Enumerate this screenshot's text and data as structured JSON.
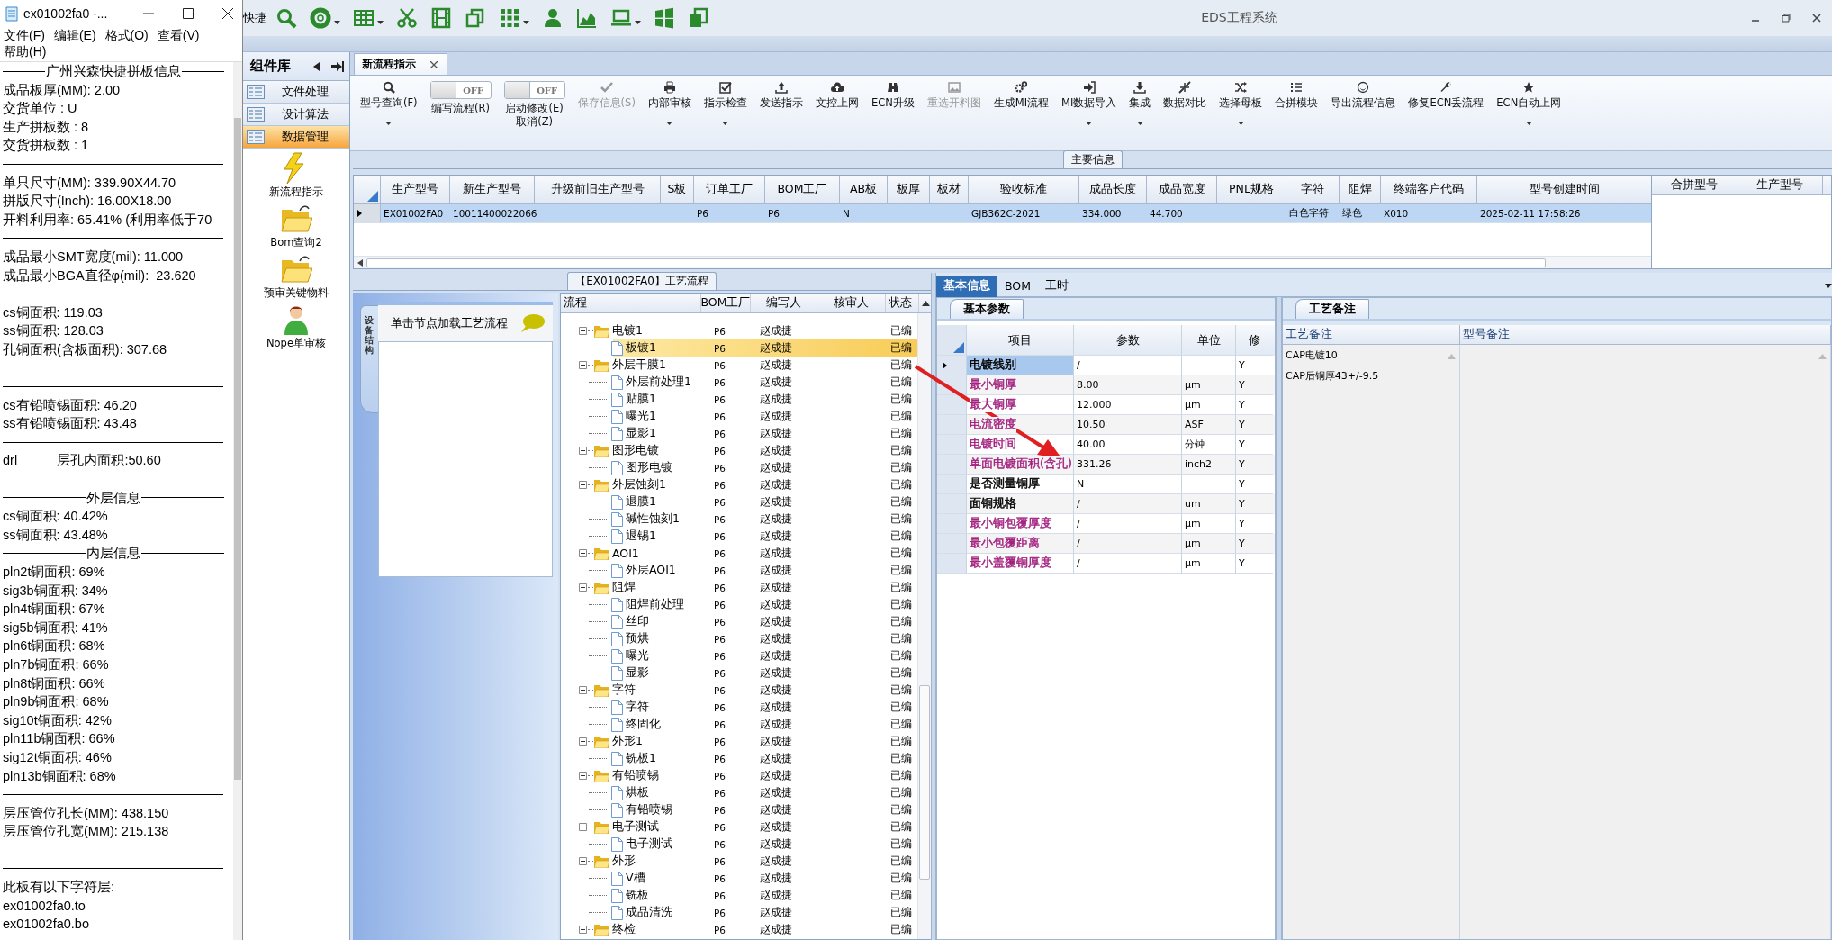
{
  "notepad": {
    "title": "ex01002fa0 -...",
    "menu": [
      "文件(F)",
      "编辑(E)",
      "格式(O)",
      "查看(V)",
      "帮助(H)"
    ],
    "lines": [
      {
        "kind": "heading",
        "text": "广州兴森快捷拼板信息"
      },
      {
        "kind": "text",
        "text": "成品板厚(MM): 2.00"
      },
      {
        "kind": "text",
        "text": "交货单位 : U"
      },
      {
        "kind": "text",
        "text": "生产拼板数 : 8"
      },
      {
        "kind": "text",
        "text": "交货拼板数 : 1"
      },
      {
        "kind": "rule"
      },
      {
        "kind": "text",
        "text": "单只尺寸(MM): 339.90X44.70"
      },
      {
        "kind": "text",
        "text": "拼版尺寸(Inch): 16.00X18.00"
      },
      {
        "kind": "text",
        "text": "开料利用率: 65.41% (利用率低于70"
      },
      {
        "kind": "rule"
      },
      {
        "kind": "text",
        "text": "成品最小SMT宽度(mil): 11.000"
      },
      {
        "kind": "text",
        "text": "成品最小BGA直径φ(mil):  23.620"
      },
      {
        "kind": "rule"
      },
      {
        "kind": "text",
        "text": "cs铜面积: 119.03"
      },
      {
        "kind": "text",
        "text": "ss铜面积: 128.03"
      },
      {
        "kind": "text",
        "text": "孔铜面积(含板面积): 307.68"
      },
      {
        "kind": "blank"
      },
      {
        "kind": "rule"
      },
      {
        "kind": "text",
        "text": "cs有铅喷锡面积: 46.20"
      },
      {
        "kind": "text",
        "text": "ss有铅喷锡面积: 43.48"
      },
      {
        "kind": "rule"
      },
      {
        "kind": "text",
        "text": "drl           层孔内面积:50.60"
      },
      {
        "kind": "blank"
      },
      {
        "kind": "heading",
        "text": "外层信息"
      },
      {
        "kind": "text",
        "text": "cs铜面积: 40.42%"
      },
      {
        "kind": "text",
        "text": "ss铜面积: 43.48%"
      },
      {
        "kind": "heading",
        "text": "内层信息"
      },
      {
        "kind": "text",
        "text": "pln2t铜面积: 69%"
      },
      {
        "kind": "text",
        "text": "sig3b铜面积: 34%"
      },
      {
        "kind": "text",
        "text": "pln4t铜面积: 67%"
      },
      {
        "kind": "text",
        "text": "sig5b铜面积: 41%"
      },
      {
        "kind": "text",
        "text": "pln6t铜面积: 68%"
      },
      {
        "kind": "text",
        "text": "pln7b铜面积: 66%"
      },
      {
        "kind": "text",
        "text": "pln8t铜面积: 66%"
      },
      {
        "kind": "text",
        "text": "pln9b铜面积: 68%"
      },
      {
        "kind": "text",
        "text": "sig10t铜面积: 42%"
      },
      {
        "kind": "text",
        "text": "pln11b铜面积: 66%"
      },
      {
        "kind": "text",
        "text": "sig12t铜面积: 46%"
      },
      {
        "kind": "text",
        "text": "pln13b铜面积: 68%"
      },
      {
        "kind": "rule"
      },
      {
        "kind": "text",
        "text": "层压管位孔长(MM): 438.150"
      },
      {
        "kind": "text",
        "text": "层压管位孔宽(MM): 215.138"
      },
      {
        "kind": "blank"
      },
      {
        "kind": "rule"
      },
      {
        "kind": "text",
        "text": "此板有以下字符层:"
      },
      {
        "kind": "text",
        "text": "ex01002fa0.to"
      },
      {
        "kind": "text",
        "text": "ex01002fa0.bo"
      }
    ]
  },
  "app": {
    "quick_label": "快捷",
    "title": "EDS工程系统"
  },
  "component_library": {
    "title": "组件库",
    "groups": [
      {
        "label": "文件处理",
        "selected": false
      },
      {
        "label": "设计算法",
        "selected": false
      },
      {
        "label": "数据管理",
        "selected": true
      }
    ],
    "tools": [
      "新流程指示",
      "Bom查询2",
      "预审关键物料",
      "Nope单审核"
    ]
  },
  "doc_tabs": [
    {
      "label": "新流程指示",
      "selected": true
    }
  ],
  "ribbon": [
    {
      "kind": "button",
      "label": "型号查询(F)",
      "disabled": false,
      "dropdown": true
    },
    {
      "kind": "toggle",
      "label": "编写流程(R)",
      "switch": "OFF",
      "on": false,
      "disabled": false
    },
    {
      "kind": "toggle",
      "label": "启动修改(E)\n取消(Z)",
      "switch": "OFF",
      "on": false,
      "disabled": false
    },
    {
      "kind": "button",
      "label": "保存信息(S)",
      "disabled": true,
      "dropdown": false
    },
    {
      "kind": "button",
      "label": "内部审核",
      "disabled": false,
      "dropdown": true
    },
    {
      "kind": "button",
      "label": "指示检查",
      "disabled": false,
      "dropdown": true
    },
    {
      "kind": "button",
      "label": "发送指示",
      "disabled": false,
      "dropdown": false
    },
    {
      "kind": "button",
      "label": "文控上网",
      "disabled": false,
      "dropdown": false
    },
    {
      "kind": "button",
      "label": "ECN升级",
      "disabled": false,
      "dropdown": false
    },
    {
      "kind": "button",
      "label": "重选开料图",
      "disabled": true,
      "dropdown": false
    },
    {
      "kind": "button",
      "label": "生成MI流程",
      "disabled": false,
      "dropdown": false
    },
    {
      "kind": "button",
      "label": "MI数据导入",
      "disabled": false,
      "dropdown": true
    },
    {
      "kind": "button",
      "label": "集成",
      "disabled": false,
      "dropdown": true
    },
    {
      "kind": "button",
      "label": "数据对比",
      "disabled": false,
      "dropdown": false
    },
    {
      "kind": "button",
      "label": "选择母板",
      "disabled": false,
      "dropdown": true
    },
    {
      "kind": "button",
      "label": "合拼模块",
      "disabled": false,
      "dropdown": false
    },
    {
      "kind": "button",
      "label": "导出流程信息",
      "disabled": false,
      "dropdown": false
    },
    {
      "kind": "button",
      "label": "修复ECN丢流程",
      "disabled": false,
      "dropdown": false
    },
    {
      "kind": "button",
      "label": "ECN自动上网",
      "disabled": false,
      "dropdown": true
    }
  ],
  "main_info": {
    "legend": "主要信息",
    "columns": [
      "生产型号",
      "新生产型号",
      "升级前旧生产型号",
      "S板",
      "订单工厂",
      "BOM工厂",
      "AB板",
      "板厚",
      "板材",
      "验收标准",
      "成品长度",
      "成品宽度",
      "PNL规格",
      "字符",
      "阻焊",
      "终端客户代码",
      "型号创建时间"
    ],
    "rows": [
      {
        "selected": true,
        "cells": [
          "EX01002FA0",
          "10011400022066",
          null,
          null,
          "P6",
          "P6",
          "N",
          null,
          null,
          "GJB362C-2021",
          "334.000",
          "44.700",
          null,
          "白色字符",
          "绿色",
          "X010",
          "2025-02-11 17:58:26"
        ]
      }
    ],
    "merge_columns": [
      "合拼型号",
      "生产型号"
    ]
  },
  "process": {
    "legend": "【EX01002FA0】工艺流程",
    "side_tab": "设备结构",
    "hint": "单击节点加载工艺流程",
    "columns": [
      "流程",
      "BOM工厂",
      "编写人",
      "核审人",
      "状态"
    ],
    "rows": [
      {
        "name": "电镀1",
        "bom": "P6",
        "writer": "赵成捷",
        "status": "已编",
        "expanded": true,
        "selected": false,
        "children": [
          {
            "name": "板镀1",
            "bom": "P6",
            "writer": "赵成捷",
            "status": "已编",
            "selected": true
          }
        ]
      },
      {
        "name": "外层干膜1",
        "bom": "P6",
        "writer": "赵成捷",
        "status": "已编",
        "expanded": true,
        "selected": false,
        "children": [
          {
            "name": "外层前处理1",
            "bom": "P6",
            "writer": "赵成捷",
            "status": "已编",
            "selected": false
          },
          {
            "name": "贴膜1",
            "bom": "P6",
            "writer": "赵成捷",
            "status": "已编",
            "selected": false
          },
          {
            "name": "曝光1",
            "bom": "P6",
            "writer": "赵成捷",
            "status": "已编",
            "selected": false
          },
          {
            "name": "显影1",
            "bom": "P6",
            "writer": "赵成捷",
            "status": "已编",
            "selected": false
          }
        ]
      },
      {
        "name": "图形电镀",
        "bom": "P6",
        "writer": "赵成捷",
        "status": "已编",
        "expanded": true,
        "selected": false,
        "children": [
          {
            "name": "图形电镀",
            "bom": "P6",
            "writer": "赵成捷",
            "status": "已编",
            "selected": false
          }
        ]
      },
      {
        "name": "外层蚀刻1",
        "bom": "P6",
        "writer": "赵成捷",
        "status": "已编",
        "expanded": true,
        "selected": false,
        "children": [
          {
            "name": "退膜1",
            "bom": "P6",
            "writer": "赵成捷",
            "status": "已编",
            "selected": false
          },
          {
            "name": "碱性蚀刻1",
            "bom": "P6",
            "writer": "赵成捷",
            "status": "已编",
            "selected": false
          },
          {
            "name": "退锡1",
            "bom": "P6",
            "writer": "赵成捷",
            "status": "已编",
            "selected": false
          }
        ]
      },
      {
        "name": "AOI1",
        "bom": "P6",
        "writer": "赵成捷",
        "status": "已编",
        "expanded": true,
        "selected": false,
        "children": [
          {
            "name": "外层AOI1",
            "bom": "P6",
            "writer": "赵成捷",
            "status": "已编",
            "selected": false
          }
        ]
      },
      {
        "name": "阻焊",
        "bom": "P6",
        "writer": "赵成捷",
        "status": "已编",
        "expanded": true,
        "selected": false,
        "children": [
          {
            "name": "阻焊前处理",
            "bom": "P6",
            "writer": "赵成捷",
            "status": "已编",
            "selected": false
          },
          {
            "name": "丝印",
            "bom": "P6",
            "writer": "赵成捷",
            "status": "已编",
            "selected": false
          },
          {
            "name": "预烘",
            "bom": "P6",
            "writer": "赵成捷",
            "status": "已编",
            "selected": false
          },
          {
            "name": "曝光",
            "bom": "P6",
            "writer": "赵成捷",
            "status": "已编",
            "selected": false
          },
          {
            "name": "显影",
            "bom": "P6",
            "writer": "赵成捷",
            "status": "已编",
            "selected": false
          }
        ]
      },
      {
        "name": "字符",
        "bom": "P6",
        "writer": "赵成捷",
        "status": "已编",
        "expanded": true,
        "selected": false,
        "children": [
          {
            "name": "字符",
            "bom": "P6",
            "writer": "赵成捷",
            "status": "已编",
            "selected": false
          },
          {
            "name": "终固化",
            "bom": "P6",
            "writer": "赵成捷",
            "status": "已编",
            "selected": false
          }
        ]
      },
      {
        "name": "外形1",
        "bom": "P6",
        "writer": "赵成捷",
        "status": "已编",
        "expanded": true,
        "selected": false,
        "children": [
          {
            "name": "铣板1",
            "bom": "P6",
            "writer": "赵成捷",
            "status": "已编",
            "selected": false
          }
        ]
      },
      {
        "name": "有铅喷锡",
        "bom": "P6",
        "writer": "赵成捷",
        "status": "已编",
        "expanded": true,
        "selected": false,
        "children": [
          {
            "name": "烘板",
            "bom": "P6",
            "writer": "赵成捷",
            "status": "已编",
            "selected": false
          },
          {
            "name": "有铅喷锡",
            "bom": "P6",
            "writer": "赵成捷",
            "status": "已编",
            "selected": false
          }
        ]
      },
      {
        "name": "电子测试",
        "bom": "P6",
        "writer": "赵成捷",
        "status": "已编",
        "expanded": true,
        "selected": false,
        "children": [
          {
            "name": "电子测试",
            "bom": "P6",
            "writer": "赵成捷",
            "status": "已编",
            "selected": false
          }
        ]
      },
      {
        "name": "外形",
        "bom": "P6",
        "writer": "赵成捷",
        "status": "已编",
        "expanded": true,
        "selected": false,
        "children": [
          {
            "name": "V槽",
            "bom": "P6",
            "writer": "赵成捷",
            "status": "已编",
            "selected": false
          },
          {
            "name": "铣板",
            "bom": "P6",
            "writer": "赵成捷",
            "status": "已编",
            "selected": false
          },
          {
            "name": "成品清洗",
            "bom": "P6",
            "writer": "赵成捷",
            "status": "已编",
            "selected": false
          }
        ]
      },
      {
        "name": "终检",
        "bom": "P6",
        "writer": "赵成捷",
        "status": "已编",
        "expanded": true,
        "selected": false
      }
    ]
  },
  "detail": {
    "tabs": [
      {
        "label": "基本信息",
        "selected": true
      },
      {
        "label": "BOM",
        "selected": false
      },
      {
        "label": "工时",
        "selected": false
      }
    ],
    "params": {
      "tab": "基本参数",
      "columns": [
        "项目",
        "参数",
        "单位",
        "修"
      ],
      "rows": [
        {
          "item": "电镀线别",
          "value": "/",
          "modified": "Y",
          "color": "#000000",
          "selected": true
        },
        {
          "item": "最小铜厚",
          "value": "8.00",
          "unit": "μm",
          "modified": "Y",
          "color": "#a3217f",
          "selected": false
        },
        {
          "item": "最大铜厚",
          "value": "12.000",
          "unit": "μm",
          "modified": "Y",
          "color": "#a3217f",
          "selected": false
        },
        {
          "item": "电流密度",
          "value": "10.50",
          "unit": "ASF",
          "modified": "Y",
          "color": "#a3217f",
          "selected": false
        },
        {
          "item": "电镀时间",
          "value": "40.00",
          "unit": "分钟",
          "modified": "Y",
          "color": "#a3217f",
          "selected": false
        },
        {
          "item": "单面电镀面积(含孔)",
          "value": "331.26",
          "unit": "inch2",
          "modified": "Y",
          "color": "#a3217f",
          "selected": false
        },
        {
          "item": "是否测量铜厚",
          "value": "N",
          "modified": "Y",
          "color": "#000000",
          "selected": false
        },
        {
          "item": "面铜规格",
          "value": "/",
          "unit": "um",
          "modified": "Y",
          "color": "#000000",
          "selected": false
        },
        {
          "item": "最小铜包覆厚度",
          "value": "/",
          "unit": "μm",
          "modified": "Y",
          "color": "#a3217f",
          "selected": false
        },
        {
          "item": "最小包覆距离",
          "value": "/",
          "unit": "μm",
          "modified": "Y",
          "color": "#a3217f",
          "selected": false
        },
        {
          "item": "最小盖覆铜厚度",
          "value": "/",
          "unit": "μm",
          "modified": "Y",
          "color": "#a3217f",
          "selected": false
        }
      ]
    },
    "remarks": {
      "tab": "工艺备注",
      "columns": [
        "工艺备注",
        "型号备注"
      ],
      "process_notes": [
        "CAP电镀10",
        "CAP后铜厚43+/-9.5"
      ]
    }
  }
}
